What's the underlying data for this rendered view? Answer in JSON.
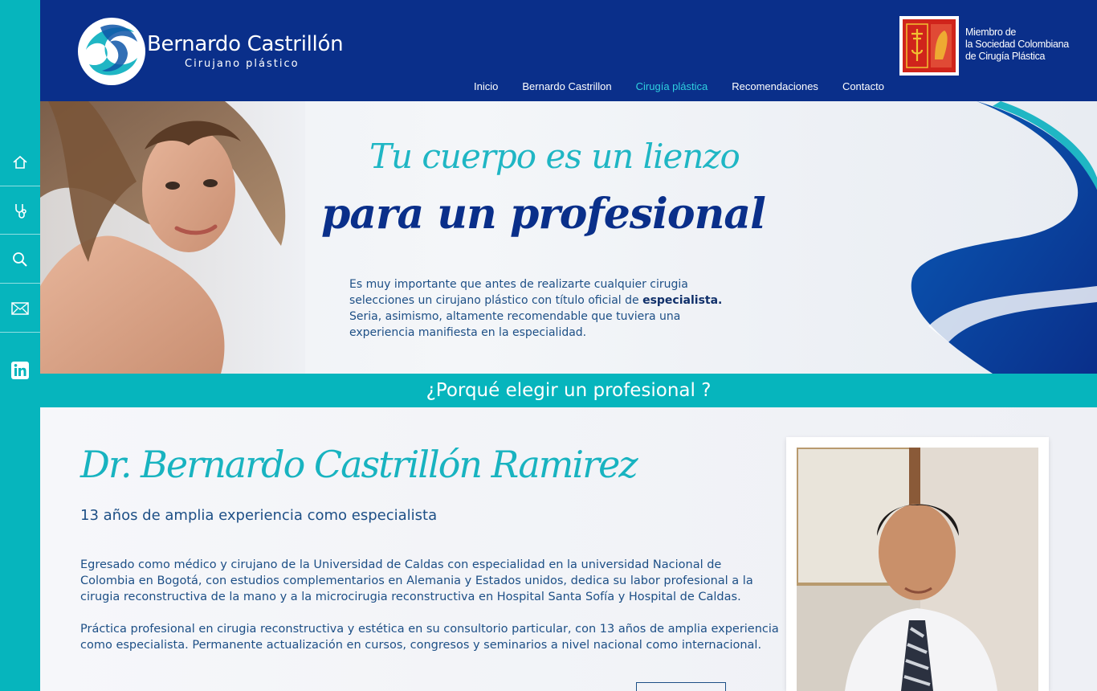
{
  "brand": {
    "name": "Bernardo Castrillón",
    "tagline": "Cirujano plástico"
  },
  "nav": {
    "items": [
      {
        "label": "Inicio",
        "active": false
      },
      {
        "label": "Bernardo Castrillon",
        "active": false
      },
      {
        "label": "Cirugía plástica",
        "active": true
      },
      {
        "label": "Recomendaciones",
        "active": false
      },
      {
        "label": "Contacto",
        "active": false
      }
    ]
  },
  "member": {
    "line1": "Miembro de",
    "line2": "la Sociedad Colombiana",
    "line3": "de Cirugía Plástica"
  },
  "sidebar": {
    "icons": [
      "home-icon",
      "stethoscope-icon",
      "search-icon",
      "mail-icon",
      "linkedin-icon"
    ]
  },
  "hero": {
    "title_line1": "Tu cuerpo es un lienzo",
    "title_line2": "para un profesional",
    "text_before": "Es muy importante que antes de realizarte cualquier cirugia selecciones un cirujano plástico con título oficial de ",
    "text_bold": "especialista.",
    "text_after": " Seria, asimismo, altamente recomendable que tuviera una experiencia manifiesta en la especialidad."
  },
  "band": {
    "title": "¿Porqué elegir un profesional ?"
  },
  "profile": {
    "name": "Dr. Bernardo Castrillón Ramirez",
    "subtitle": "13 años de amplia experiencia como especialista",
    "paragraph1": "Egresado como médico y cirujano de la Universidad de Caldas con especialidad en la universidad Nacional de Colombia en Bogotá, con estudios complementarios en Alemania y Estados unidos, dedica su labor profesional a la cirugia reconstructiva de la mano y a la microcirugia reconstructiva en Hospital Santa Sofía y Hospital de Caldas.",
    "paragraph2": "Práctica profesional en cirugia reconstructiva y estética en su consultorio particular, con 13 años de amplia experiencia como especialista. Permanente actualización en cursos, congresos y seminarios a nivel nacional como internacional."
  },
  "colors": {
    "header_bg": "#0a2f8a",
    "teal": "#06b5bd",
    "nav_active": "#2fd0e0",
    "text_blue": "#1d4f86"
  }
}
